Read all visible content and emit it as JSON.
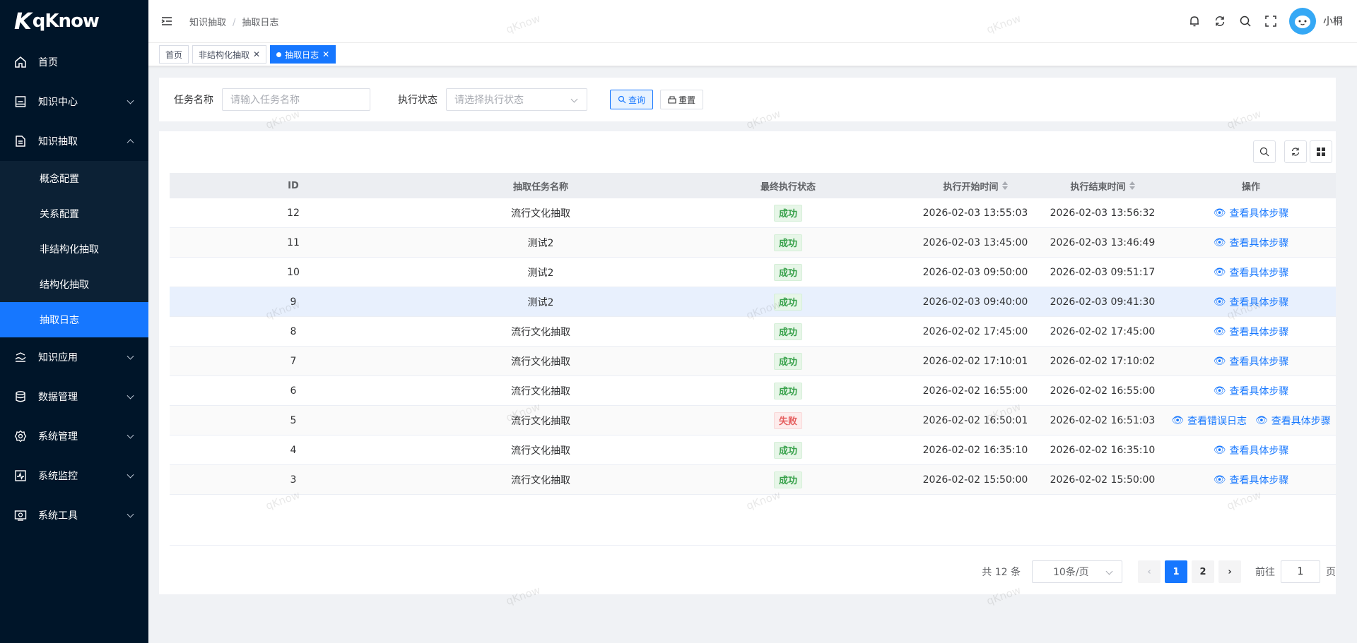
{
  "app": {
    "logo_text": "qKnow",
    "logo_mark": "K"
  },
  "sidebar": {
    "items": [
      {
        "label": "首页",
        "icon": "home-icon"
      },
      {
        "label": "知识中心",
        "icon": "knowledge-icon"
      },
      {
        "label": "知识抽取",
        "icon": "extract-icon"
      },
      {
        "label": "知识应用",
        "icon": "app-icon"
      },
      {
        "label": "数据管理",
        "icon": "database-icon"
      },
      {
        "label": "系统管理",
        "icon": "settings-icon"
      },
      {
        "label": "系统监控",
        "icon": "monitor-icon"
      },
      {
        "label": "系统工具",
        "icon": "tools-icon"
      }
    ],
    "sub_items": [
      "概念配置",
      "关系配置",
      "非结构化抽取",
      "结构化抽取",
      "抽取日志"
    ]
  },
  "navbar": {
    "breadcrumb": [
      "知识抽取",
      "抽取日志"
    ],
    "breadcrumb_sep": "/",
    "username": "小桐"
  },
  "tags": {
    "items": [
      "首页",
      "非结构化抽取",
      "抽取日志"
    ],
    "close": "✕"
  },
  "search": {
    "task_label": "任务名称",
    "task_placeholder": "请输入任务名称",
    "status_label": "执行状态",
    "status_placeholder": "请选择执行状态",
    "query_label": "查询",
    "reset_label": "重置"
  },
  "table": {
    "columns": [
      "ID",
      "抽取任务名称",
      "最终执行状态",
      "执行开始时间",
      "执行结束时间",
      "操作"
    ],
    "action_view": "查看具体步骤",
    "action_error": "查看错误日志",
    "rows": [
      {
        "id": "12",
        "name": "流行文化抽取",
        "status": "成功",
        "start": "2026-02-03 13:55:03",
        "end": "2026-02-03 13:56:32"
      },
      {
        "id": "11",
        "name": "测试2",
        "status": "成功",
        "start": "2026-02-03 13:45:00",
        "end": "2026-02-03 13:46:49"
      },
      {
        "id": "10",
        "name": "测试2",
        "status": "成功",
        "start": "2026-02-03 09:50:00",
        "end": "2026-02-03 09:51:17"
      },
      {
        "id": "9",
        "name": "测试2",
        "status": "成功",
        "start": "2026-02-03 09:40:00",
        "end": "2026-02-03 09:41:30"
      },
      {
        "id": "8",
        "name": "流行文化抽取",
        "status": "成功",
        "start": "2026-02-02 17:45:00",
        "end": "2026-02-02 17:45:00"
      },
      {
        "id": "7",
        "name": "流行文化抽取",
        "status": "成功",
        "start": "2026-02-02 17:10:01",
        "end": "2026-02-02 17:10:02"
      },
      {
        "id": "6",
        "name": "流行文化抽取",
        "status": "成功",
        "start": "2026-02-02 16:55:00",
        "end": "2026-02-02 16:55:00"
      },
      {
        "id": "5",
        "name": "流行文化抽取",
        "status": "失败",
        "start": "2026-02-02 16:50:01",
        "end": "2026-02-02 16:51:03"
      },
      {
        "id": "4",
        "name": "流行文化抽取",
        "status": "成功",
        "start": "2026-02-02 16:35:10",
        "end": "2026-02-02 16:35:10"
      },
      {
        "id": "3",
        "name": "流行文化抽取",
        "status": "成功",
        "start": "2026-02-02 15:50:00",
        "end": "2026-02-02 15:50:00"
      }
    ]
  },
  "pagination": {
    "total_text": "共 12 条",
    "page_size": "10条/页",
    "pages": [
      "1",
      "2"
    ],
    "current": "1",
    "goto_prefix": "前往",
    "goto_value": "1",
    "goto_suffix": "页"
  },
  "watermark": "qKnow",
  "colors": {
    "sidebar_bg": "#001529",
    "accent": "#1677ff",
    "success": "#37a14a",
    "fail": "#e55e5e"
  }
}
